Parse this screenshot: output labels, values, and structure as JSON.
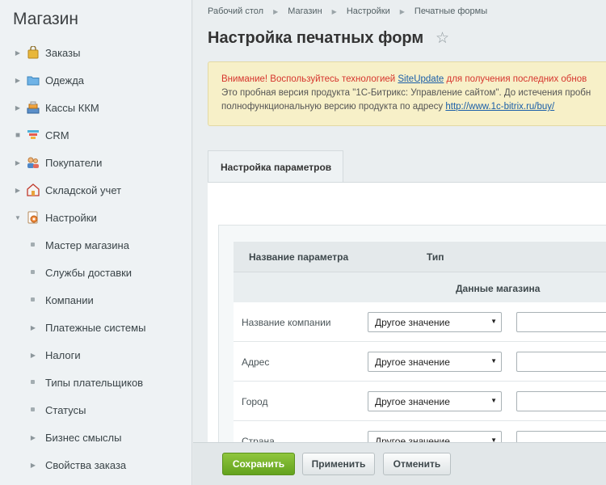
{
  "sidebar": {
    "title": "Магазин",
    "items": [
      {
        "label": "Заказы",
        "icon": "shopping-bag-icon"
      },
      {
        "label": "Одежда",
        "icon": "folder-icon"
      },
      {
        "label": "Кассы ККМ",
        "icon": "cash-register-icon"
      },
      {
        "label": "CRM",
        "icon": "crm-funnel-icon"
      },
      {
        "label": "Покупатели",
        "icon": "users-icon"
      },
      {
        "label": "Складской учет",
        "icon": "warehouse-icon"
      },
      {
        "label": "Настройки",
        "icon": "settings-icon"
      }
    ],
    "subitems": [
      {
        "label": "Мастер магазина"
      },
      {
        "label": "Службы доставки"
      },
      {
        "label": "Компании"
      },
      {
        "label": "Платежные системы"
      },
      {
        "label": "Налоги"
      },
      {
        "label": "Типы плательщиков"
      },
      {
        "label": "Статусы"
      },
      {
        "label": "Бизнес смыслы"
      },
      {
        "label": "Свойства заказа"
      }
    ]
  },
  "breadcrumb": [
    "Рабочий стол",
    "Магазин",
    "Настройки",
    "Печатные формы"
  ],
  "page_title": "Настройка печатных форм",
  "notice": {
    "line1_red": "Внимание! Воспользуйтесь технологией",
    "line1_link": "SiteUpdate",
    "line1_red2": "для получения последних обнов",
    "line2": "Это пробная версия продукта \"1С-Битрикс: Управление сайтом\". До истечения пробн",
    "line3": "полнофункциональную версию продукта по адресу",
    "line3_link": "http://www.1c-bitrix.ru/buy/"
  },
  "tab_label": "Настройка параметров",
  "table": {
    "col_name": "Название параметра",
    "col_type": "Тип",
    "group": "Данные магазина",
    "rows": [
      {
        "label": "Название компании",
        "select": "Другое значение"
      },
      {
        "label": "Адрес",
        "select": "Другое значение"
      },
      {
        "label": "Город",
        "select": "Другое значение"
      },
      {
        "label": "Страна",
        "select": "Другое значение"
      }
    ]
  },
  "buttons": {
    "save": "Сохранить",
    "apply": "Применить",
    "cancel": "Отменить"
  },
  "colors": {
    "save_button": "#63a21e",
    "notice_bg": "#f7f0c8",
    "warning_text": "#d6352d",
    "link": "#1a5ea8"
  }
}
